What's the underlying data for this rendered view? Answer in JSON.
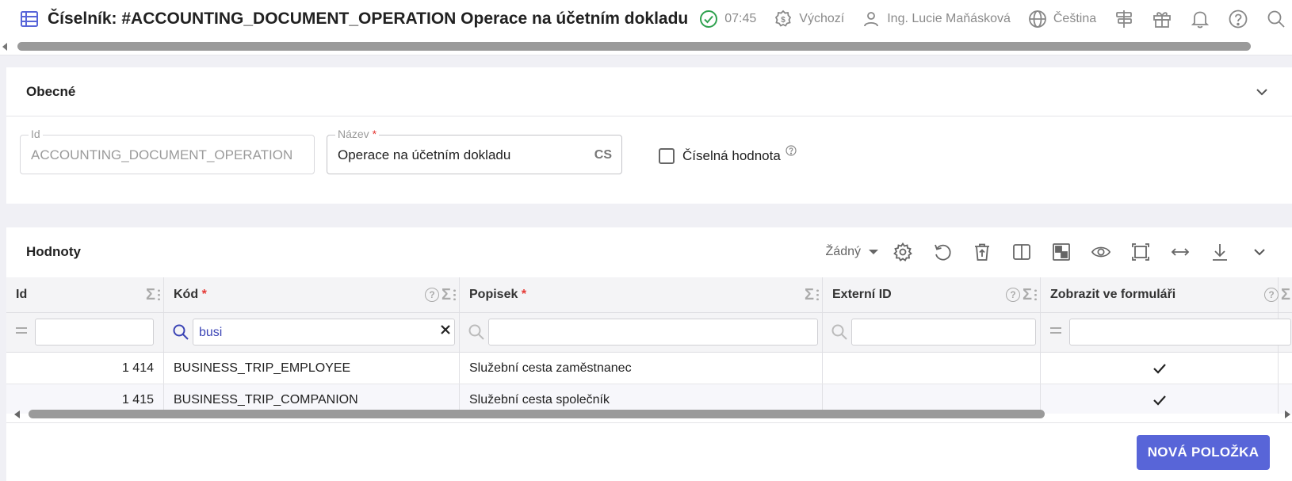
{
  "header": {
    "title": "Číselník: #ACCOUNTING_DOCUMENT_OPERATION Operace na účetním dokladu",
    "time": "07:45",
    "currency_label": "Výchozí",
    "user_name": "Ing. Lucie Maňásková",
    "language": "Čeština",
    "icons": [
      "table-icon",
      "check-circle-icon",
      "dollar-circle-icon",
      "user-icon",
      "globe-icon",
      "signpost-icon",
      "gift-icon",
      "bell-icon",
      "help-icon",
      "search-icon"
    ]
  },
  "general": {
    "title": "Obecné",
    "id_label": "Id",
    "id_value": "ACCOUNTING_DOCUMENT_OPERATION",
    "name_label": "Název",
    "name_required": "*",
    "name_value": "Operace na účetním dokladu",
    "name_lang": "CS",
    "numeric_label": "Číselná hodnota",
    "numeric_checked": false
  },
  "values": {
    "title": "Hodnoty",
    "grouping_value": "Žádný",
    "columns": [
      {
        "label": "Id",
        "required": ""
      },
      {
        "label": "Kód",
        "required": "*"
      },
      {
        "label": "Popisek",
        "required": "*"
      },
      {
        "label": "Externí ID",
        "required": ""
      },
      {
        "label": "Zobrazit ve formuláři",
        "required": ""
      }
    ],
    "filter_code_value": "busi",
    "rows": [
      {
        "id": "1 414",
        "code": "BUSINESS_TRIP_EMPLOYEE",
        "label": "Služební cesta zaměstnanec",
        "external_id": "",
        "show_in_form": true
      },
      {
        "id": "1 415",
        "code": "BUSINESS_TRIP_COMPANION",
        "label": "Služební cesta společník",
        "external_id": "",
        "show_in_form": true
      }
    ],
    "new_item_label": "NOVÁ POLOŽKA"
  },
  "colors": {
    "accent": "#5865d8",
    "success": "#2fa14f",
    "required": "#e53935"
  }
}
